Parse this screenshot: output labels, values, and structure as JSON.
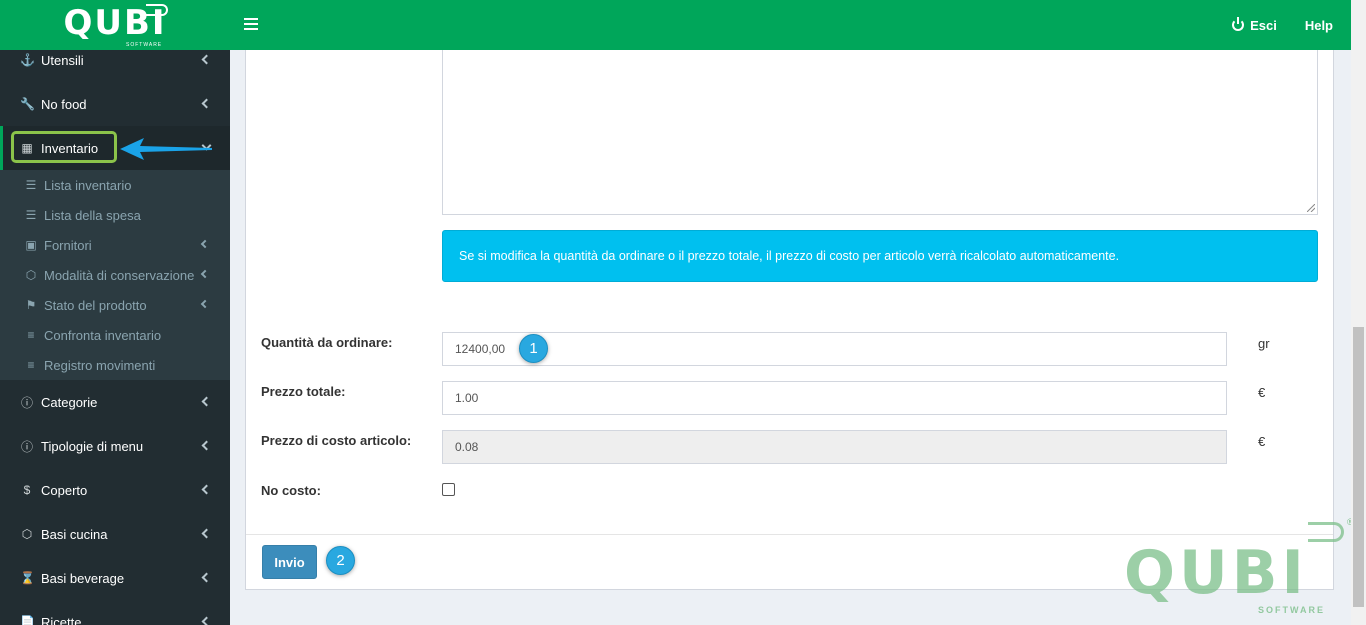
{
  "brand": {
    "name": "QUBI",
    "subtitle": "SOFTWARE"
  },
  "header": {
    "logout_label": "Esci",
    "help_label": "Help"
  },
  "sidebar": {
    "items_top": [
      {
        "label": "Utensili",
        "icon": "utensils-icon"
      },
      {
        "label": "No food",
        "icon": "wrench-icon"
      }
    ],
    "active": {
      "label": "Inventario",
      "icon": "table-icon"
    },
    "submenu": [
      {
        "label": "Lista inventario",
        "icon": "list-icon"
      },
      {
        "label": "Lista della spesa",
        "icon": "list-ol-icon"
      },
      {
        "label": "Fornitori",
        "icon": "truck-icon",
        "expandable": true
      },
      {
        "label": "Modalità di conservazione",
        "icon": "cube-icon",
        "expandable": true
      },
      {
        "label": "Stato del prodotto",
        "icon": "flag-icon",
        "expandable": true
      },
      {
        "label": "Confronta inventario",
        "icon": "bars-icon"
      },
      {
        "label": "Registro movimenti",
        "icon": "bars-icon"
      }
    ],
    "items_bottom": [
      {
        "label": "Categorie",
        "icon": "info-circle-icon"
      },
      {
        "label": "Tipologie di menu",
        "icon": "info-circle-icon"
      },
      {
        "label": "Coperto",
        "icon": "dollar-icon"
      },
      {
        "label": "Basi cucina",
        "icon": "cube-icon"
      },
      {
        "label": "Basi beverage",
        "icon": "hourglass-icon"
      },
      {
        "label": "Ricette",
        "icon": "file-icon"
      }
    ]
  },
  "form": {
    "info_message": "Se si modifica la quantità da ordinare o il prezzo totale, il prezzo di costo per articolo verrà ricalcolato automaticamente.",
    "quantity": {
      "label": "Quantità da ordinare:",
      "value": "12400,00",
      "unit": "gr"
    },
    "total_price": {
      "label": "Prezzo totale:",
      "value": "1.00",
      "unit": "€"
    },
    "unit_cost": {
      "label": "Prezzo di costo articolo:",
      "value": "0.08",
      "unit": "€"
    },
    "no_cost": {
      "label": "No costo:",
      "checked": false
    },
    "submit_label": "Invio"
  },
  "annotations": {
    "badge_1": "1",
    "badge_2": "2"
  },
  "colors": {
    "header_green": "#00a65a",
    "sidebar_dark": "#222d32",
    "info_blue": "#00c0ef",
    "button_blue": "#3c8dbc",
    "highlight_green": "#8bc34a",
    "badge_blue": "#29a8e0"
  }
}
